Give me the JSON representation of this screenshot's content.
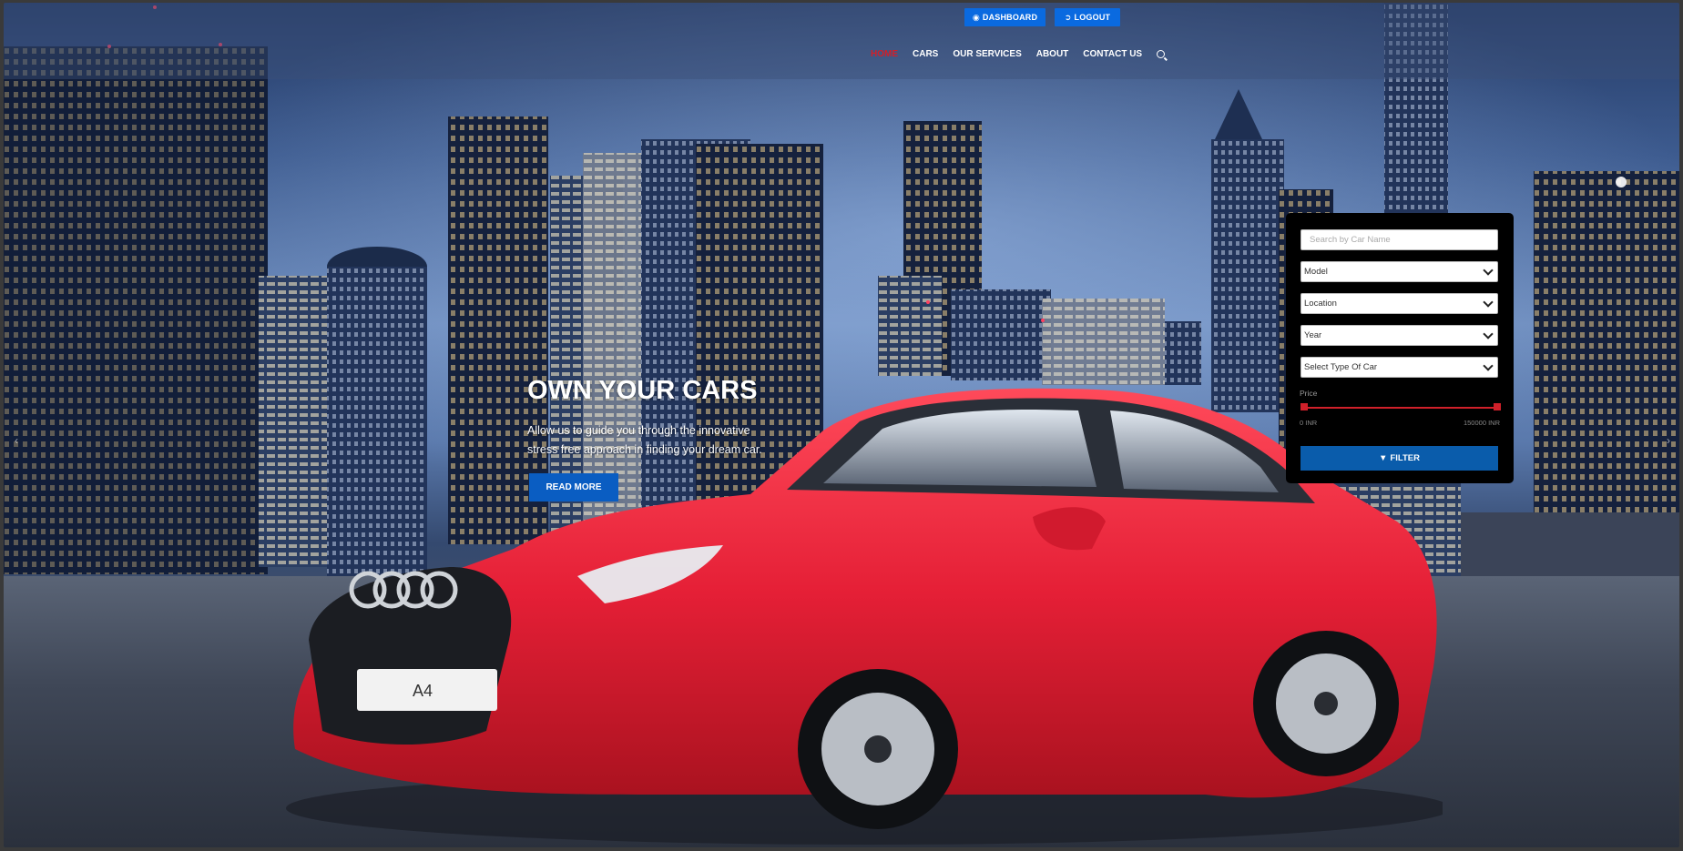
{
  "header": {
    "dashboard_label": "DASHBOARD",
    "logout_label": "LOGOUT",
    "nav": [
      "HOME",
      "CARS",
      "OUR SERVICES",
      "ABOUT",
      "CONTACT US"
    ],
    "active_nav": "HOME"
  },
  "hero": {
    "title": "OWN YOUR CARS",
    "subtitle": "Allow us to guide you through the innovative stress free approach in finding your dream car.",
    "cta_label": "READ MORE",
    "plate_text": "A4"
  },
  "filter": {
    "search_placeholder": "Search by Car Name",
    "model_label": "Model",
    "location_label": "Location",
    "year_label": "Year",
    "type_label": "Select Type Of Car",
    "price_label": "Price",
    "price_min": "0 INR",
    "price_max": "150000 INR",
    "button_label": "FILTER"
  },
  "colors": {
    "accent_blue": "#0a6ae0",
    "active_red": "#d0202a",
    "car_red": "#e0203a"
  },
  "icons": {
    "dashboard": "dashboard-icon",
    "logout": "logout-icon",
    "search": "search-icon",
    "filter": "filter-icon",
    "chevron": "chevron-down-icon"
  }
}
